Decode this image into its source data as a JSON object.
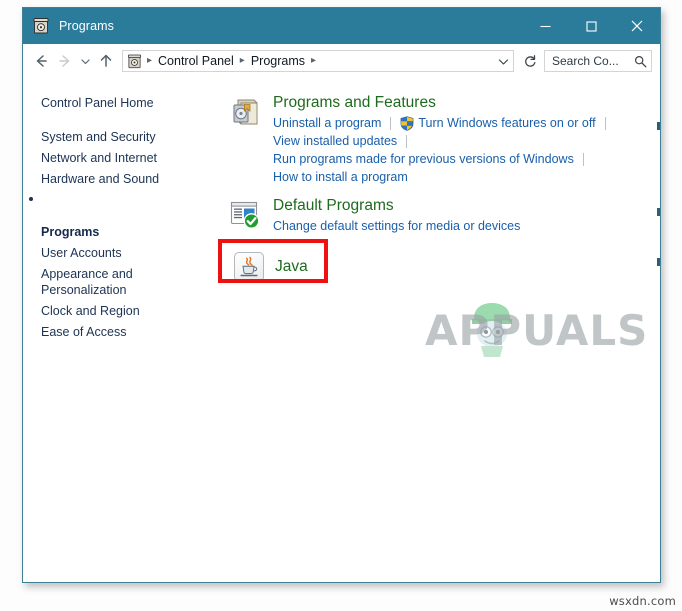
{
  "window": {
    "title": "Programs",
    "icon": "control-panel-icon",
    "controls": {
      "minimize": "–",
      "maximize": "☐",
      "close": "✕"
    },
    "titlebar_color": "#2b7c9b",
    "border_color": "#3e8196"
  },
  "navbar": {
    "back": "←",
    "forward": "→",
    "recent": "⌄",
    "up": "↑",
    "breadcrumb": {
      "icon": "control-panel-icon",
      "items": [
        "Control Panel",
        "Programs"
      ],
      "separator": "›",
      "trailing_separator": "›",
      "dropdown": "⌄"
    },
    "refresh": "↻",
    "search": {
      "value": "Search Co...",
      "placeholder": "Search Control Panel",
      "icon": "search-icon"
    }
  },
  "sidebar": {
    "items": [
      {
        "label": "Control Panel Home",
        "current": false,
        "home": true
      },
      {
        "label": "System and Security",
        "current": false
      },
      {
        "label": "Network and Internet",
        "current": false
      },
      {
        "label": "Hardware and Sound",
        "current": false
      },
      {
        "label": "Programs",
        "current": true
      },
      {
        "label": "User Accounts",
        "current": false
      },
      {
        "label": "Appearance and\nPersonalization",
        "current": false
      },
      {
        "label": "Clock and Region",
        "current": false
      },
      {
        "label": "Ease of Access",
        "current": false
      }
    ]
  },
  "content": {
    "groups": [
      {
        "title": "Programs and Features",
        "icon": "programs-and-features-icon",
        "lines": [
          [
            {
              "text": "Uninstall a program",
              "shield": false
            },
            {
              "divider": true
            },
            {
              "text": "Turn Windows features on or off",
              "shield": true
            },
            {
              "divider": true
            }
          ],
          [
            {
              "text": "View installed updates",
              "shield": false
            },
            {
              "divider": true
            }
          ],
          [
            {
              "text": "Run programs made for previous versions of Windows",
              "shield": false
            },
            {
              "divider": true
            }
          ],
          [
            {
              "text": "How to install a program",
              "shield": false
            }
          ]
        ]
      },
      {
        "title": "Default Programs",
        "icon": "default-programs-icon",
        "lines": [
          [
            {
              "text": "Change default settings for media or devices",
              "shield": false
            }
          ]
        ]
      }
    ],
    "java": {
      "label": "Java",
      "icon": "java-coffee-cup-icon",
      "highlight_color": "#ee1111",
      "highlighted": true
    },
    "heading_color": "#1e6b1e",
    "link_color": "#1a5faa"
  },
  "watermark": {
    "text": "APPUALS",
    "mascot": "appuals-mascot-icon"
  },
  "credit": "wsxdn.com"
}
